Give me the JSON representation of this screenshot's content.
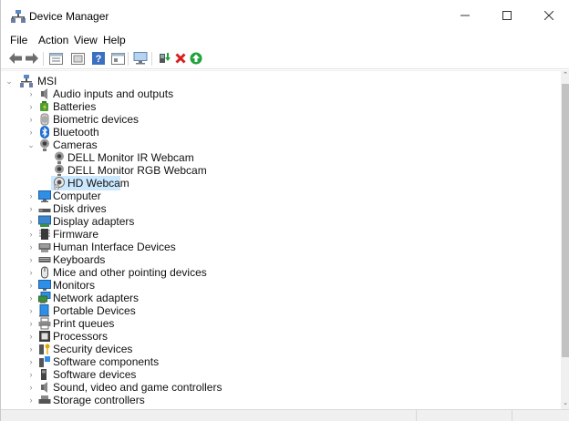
{
  "window": {
    "title": "Device Manager",
    "controls": {
      "minimize": "–",
      "maximize": "☐",
      "close": "✕"
    }
  },
  "menu": [
    "File",
    "Action",
    "View",
    "Help"
  ],
  "toolbar": {
    "buttons": [
      "back-icon",
      "forward-icon",
      "properties-icon",
      "show-hidden-icon",
      "help-icon",
      "view-icon",
      "monitor-icon",
      "update-driver-icon",
      "uninstall-icon",
      "enable-device-icon"
    ]
  },
  "tree": {
    "root": "MSI",
    "categories": [
      "Audio inputs and outputs",
      "Batteries",
      "Biometric devices",
      "Bluetooth",
      "Cameras",
      "Computer",
      "Disk drives",
      "Display adapters",
      "Firmware",
      "Human Interface Devices",
      "Keyboards",
      "Mice and other pointing devices",
      "Monitors",
      "Network adapters",
      "Portable Devices",
      "Print queues",
      "Processors",
      "Security devices",
      "Software components",
      "Software devices",
      "Sound, video and game controllers",
      "Storage controllers"
    ],
    "cameras": [
      "DELL Monitor IR Webcam",
      "DELL Monitor RGB Webcam",
      "HD Webcam"
    ],
    "selected": "HD Webcam"
  },
  "colors": {
    "selection": "#cce8ff",
    "accent_green": "#1fa33a",
    "accent_red": "#d62020"
  }
}
